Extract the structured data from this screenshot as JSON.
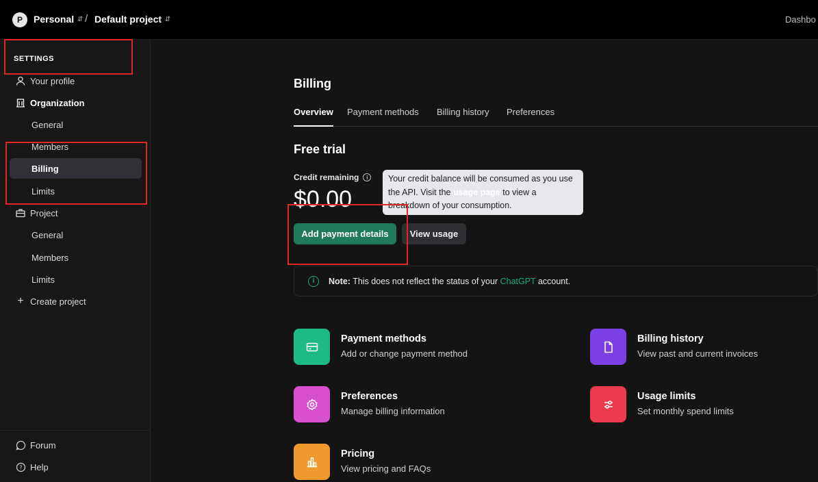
{
  "topbar": {
    "avatar_letter": "P",
    "org": "Personal",
    "separator": "/",
    "project": "Default project",
    "right_link": "Dashbo"
  },
  "sidebar": {
    "title": "SETTINGS",
    "items": [
      {
        "label": "Your profile",
        "icon": "person-icon"
      },
      {
        "label": "Organization",
        "icon": "building-icon"
      },
      {
        "label": "General"
      },
      {
        "label": "Members"
      },
      {
        "label": "Billing",
        "active": true
      },
      {
        "label": "Limits"
      },
      {
        "label": "Project",
        "icon": "briefcase-icon"
      },
      {
        "label": "General"
      },
      {
        "label": "Members"
      },
      {
        "label": "Limits"
      },
      {
        "label": "Create project",
        "icon": "plus-icon"
      }
    ],
    "footer": [
      {
        "label": "Forum",
        "icon": "chat-bubble-icon"
      },
      {
        "label": "Help",
        "icon": "question-circle-icon"
      }
    ]
  },
  "main": {
    "heading": "Billing",
    "tabs": [
      "Overview",
      "Payment methods",
      "Billing history",
      "Preferences"
    ],
    "active_tab": "Overview",
    "plan": "Free trial",
    "credit_label": "Credit remaining",
    "credit_amount": "$0.00",
    "tooltip": {
      "before": "Your credit balance will be consumed as you use the API. Visit the ",
      "link": "usage page",
      "after": " to view a breakdown of your consumption."
    },
    "buttons": {
      "primary": "Add payment details",
      "secondary": "View usage"
    },
    "note": {
      "label": "Note:",
      "text": " This does not reflect the status of your ",
      "link": "ChatGPT",
      "tail": " account."
    },
    "cards": [
      {
        "title": "Payment methods",
        "subtitle": "Add or change payment method",
        "color": "#1fb985",
        "icon": "credit-card-icon"
      },
      {
        "title": "Billing history",
        "subtitle": "View past and current invoices",
        "color": "#7b3fe4",
        "icon": "document-icon"
      },
      {
        "title": "Preferences",
        "subtitle": "Manage billing information",
        "color": "#d84fd0",
        "icon": "gear-icon"
      },
      {
        "title": "Usage limits",
        "subtitle": "Set monthly spend limits",
        "color": "#ec3a4e",
        "icon": "sliders-icon"
      },
      {
        "title": "Pricing",
        "subtitle": "View pricing and FAQs",
        "color": "#ef9a2e",
        "icon": "bar-chart-icon"
      }
    ]
  },
  "annotation_color": "#e0262b"
}
